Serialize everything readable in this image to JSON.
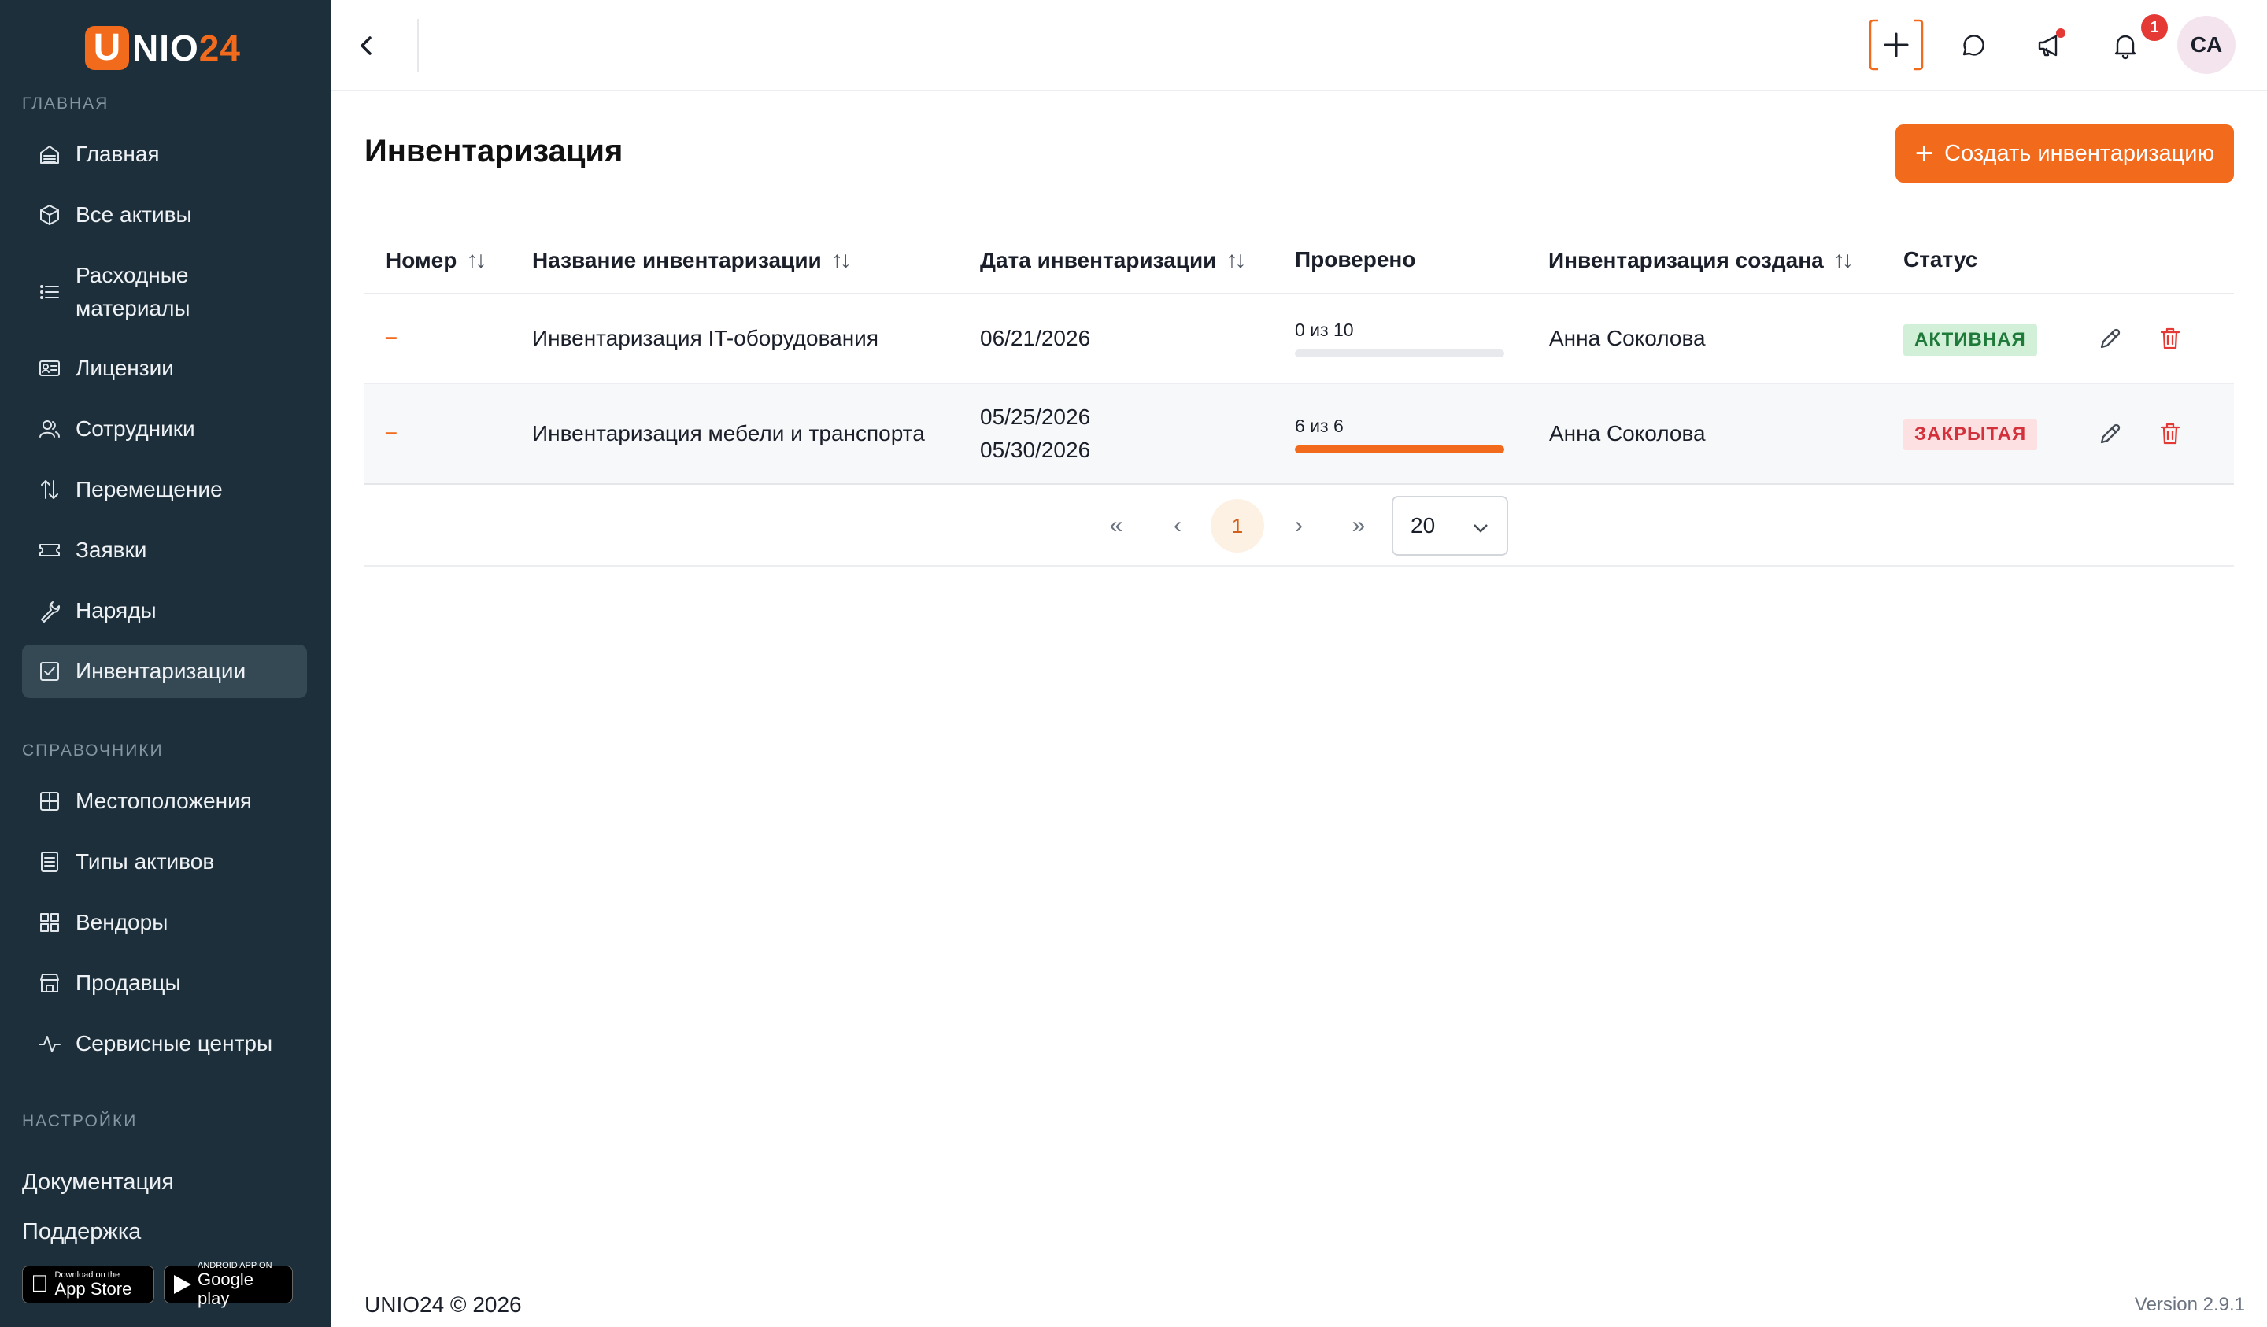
{
  "brand": {
    "u": "U",
    "nio": "NIO",
    "num": "24"
  },
  "sidebar": {
    "sections": {
      "main": "ГЛАВНАЯ",
      "references": "СПРАВОЧНИКИ",
      "settings": "НАСТРОЙКИ"
    },
    "main_items": [
      {
        "label": "Главная",
        "icon": "home-icon"
      },
      {
        "label": "Все активы",
        "icon": "box-icon"
      },
      {
        "label": "Расходные материалы",
        "icon": "list-icon"
      },
      {
        "label": "Лицензии",
        "icon": "license-icon"
      },
      {
        "label": "Сотрудники",
        "icon": "users-icon"
      },
      {
        "label": "Перемещение",
        "icon": "transfer-icon"
      },
      {
        "label": "Заявки",
        "icon": "ticket-icon"
      },
      {
        "label": "Наряды",
        "icon": "wrench-icon"
      },
      {
        "label": "Инвентаризации",
        "icon": "checklist-icon",
        "active": true
      }
    ],
    "main_item_lines": [
      "Расходные",
      "материалы"
    ],
    "reference_items": [
      {
        "label": "Местоположения",
        "icon": "grid-icon"
      },
      {
        "label": "Типы активов",
        "icon": "document-icon"
      },
      {
        "label": "Вендоры",
        "icon": "apps-icon"
      },
      {
        "label": "Продавцы",
        "icon": "store-icon"
      },
      {
        "label": "Сервисные центры",
        "icon": "pulse-icon"
      }
    ],
    "links": {
      "docs": "Документация",
      "support": "Поддержка"
    },
    "badges": {
      "appstore_small": "Download on the",
      "appstore_big": "App Store",
      "google_small": "ANDROID APP ON",
      "google_big": "Google play"
    }
  },
  "topbar": {
    "notification_count": "1",
    "avatar_initials": "CA"
  },
  "page": {
    "title": "Инвентаризация",
    "create_button": "Создать инвентаризацию"
  },
  "table": {
    "columns": {
      "number": "Номер",
      "name": "Название инвентаризации",
      "date": "Дата инвентаризации",
      "checked": "Проверено",
      "created_by": "Инвентаризация создана",
      "status": "Статус"
    },
    "rows": [
      {
        "number": "–",
        "name": "Инвентаризация IT-оборудования",
        "date_start": "06/21/2026",
        "date_end": "",
        "checked_text": "0 из 10",
        "checked_fraction": 0,
        "created_by": "Анна Соколова",
        "status": "АКТИВНАЯ"
      },
      {
        "number": "–",
        "name": "Инвентаризация мебели и транспорта",
        "date_start": "05/25/2026",
        "date_end": "05/30/2026",
        "checked_text": "6 из 6",
        "checked_fraction": 1,
        "created_by": "Анна Соколова",
        "status": "ЗАКРЫТАЯ"
      }
    ]
  },
  "pagination": {
    "current_page": "1",
    "page_size": "20"
  },
  "footer": {
    "copyright": "UNIO24 © 2026",
    "version": "Version 2.9.1"
  },
  "colors": {
    "accent": "#f26b1d",
    "sidebar_bg": "#1d2f3a",
    "active_badge_bg": "#d2f0d8",
    "closed_badge_bg": "#fde0e2"
  }
}
